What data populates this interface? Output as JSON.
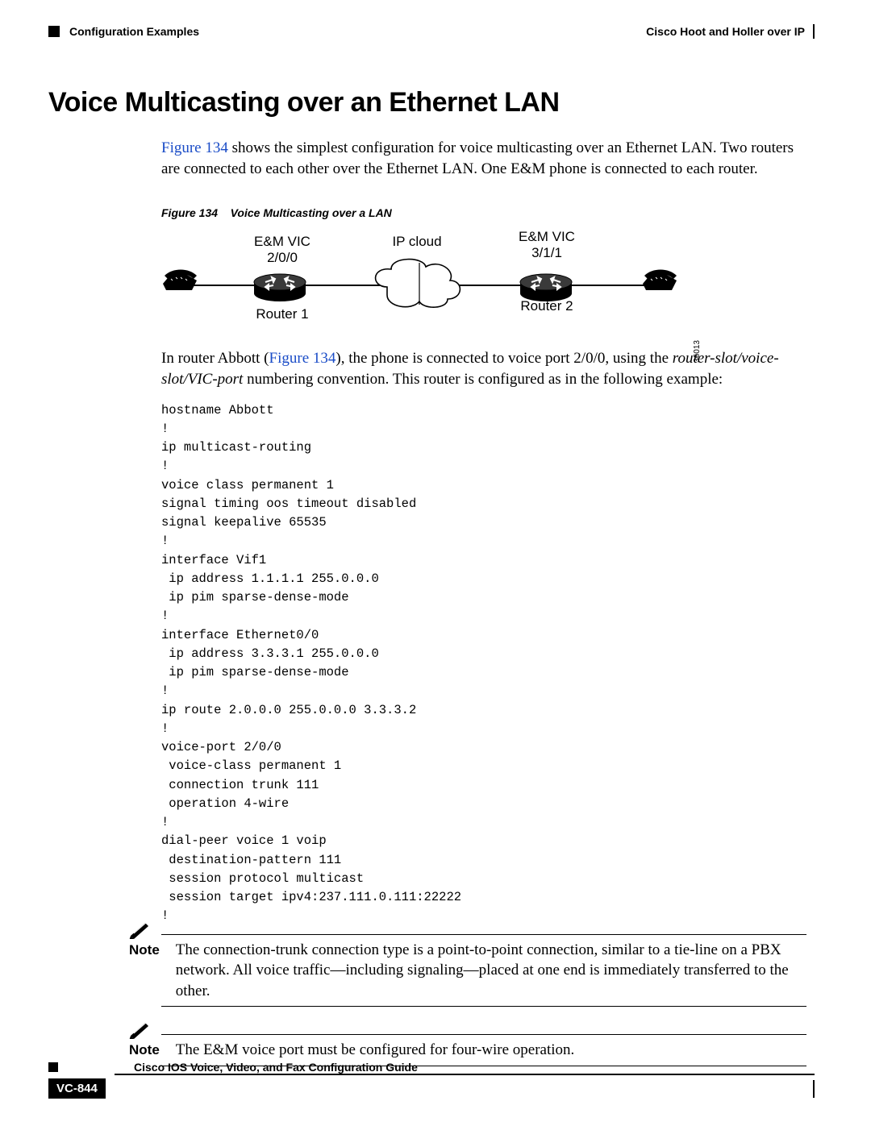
{
  "header": {
    "left": "Configuration Examples",
    "right": "Cisco Hoot and Holler over IP"
  },
  "h1": "Voice Multicasting over an Ethernet LAN",
  "intro_link": "Figure 134",
  "intro_rest": " shows the simplest configuration for voice multicasting over an Ethernet LAN. Two routers are connected to each other over the Ethernet LAN. One E&M phone is connected to each router.",
  "fig_caption_num": "Figure 134",
  "fig_caption_title": "Voice Multicasting over a LAN",
  "fig": {
    "em_left_top": "E&M VIC",
    "em_left_bot": "2/0/0",
    "ip_cloud": "IP cloud",
    "em_right_top": "E&M VIC",
    "em_right_bot": "3/1/1",
    "router1": "Router 1",
    "router2": "Router 2",
    "id": "36013"
  },
  "para2_pre": "In router Abbott (",
  "para2_link": "Figure 134",
  "para2_mid": "), the phone is connected to voice port 2/0/0, using the ",
  "para2_italic": "router-slot/voice-slot/VIC-port",
  "para2_post": " numbering convention. This router is configured as in the following example:",
  "code": "hostname Abbott\n!\nip multicast-routing\n!\nvoice class permanent 1\nsignal timing oos timeout disabled\nsignal keepalive 65535\n!\ninterface Vif1\n ip address 1.1.1.1 255.0.0.0\n ip pim sparse-dense-mode\n!\ninterface Ethernet0/0\n ip address 3.3.3.1 255.0.0.0\n ip pim sparse-dense-mode\n!\nip route 2.0.0.0 255.0.0.0 3.3.3.2\n!\nvoice-port 2/0/0\n voice-class permanent 1\n connection trunk 111\n operation 4-wire\n!\ndial-peer voice 1 voip\n destination-pattern 111\n session protocol multicast\n session target ipv4:237.111.0.111:22222\n!",
  "note1_label": "Note",
  "note1_text": "The connection-trunk connection type is a point-to-point connection, similar to a tie-line on a PBX network. All voice traffic—including signaling—placed at one end is immediately transferred to the other.",
  "note2_label": "Note",
  "note2_text": "The E&M voice port must be configured for four-wire operation.",
  "footer_title": "Cisco IOS Voice, Video, and Fax Configuration Guide",
  "page_num": "VC-844"
}
